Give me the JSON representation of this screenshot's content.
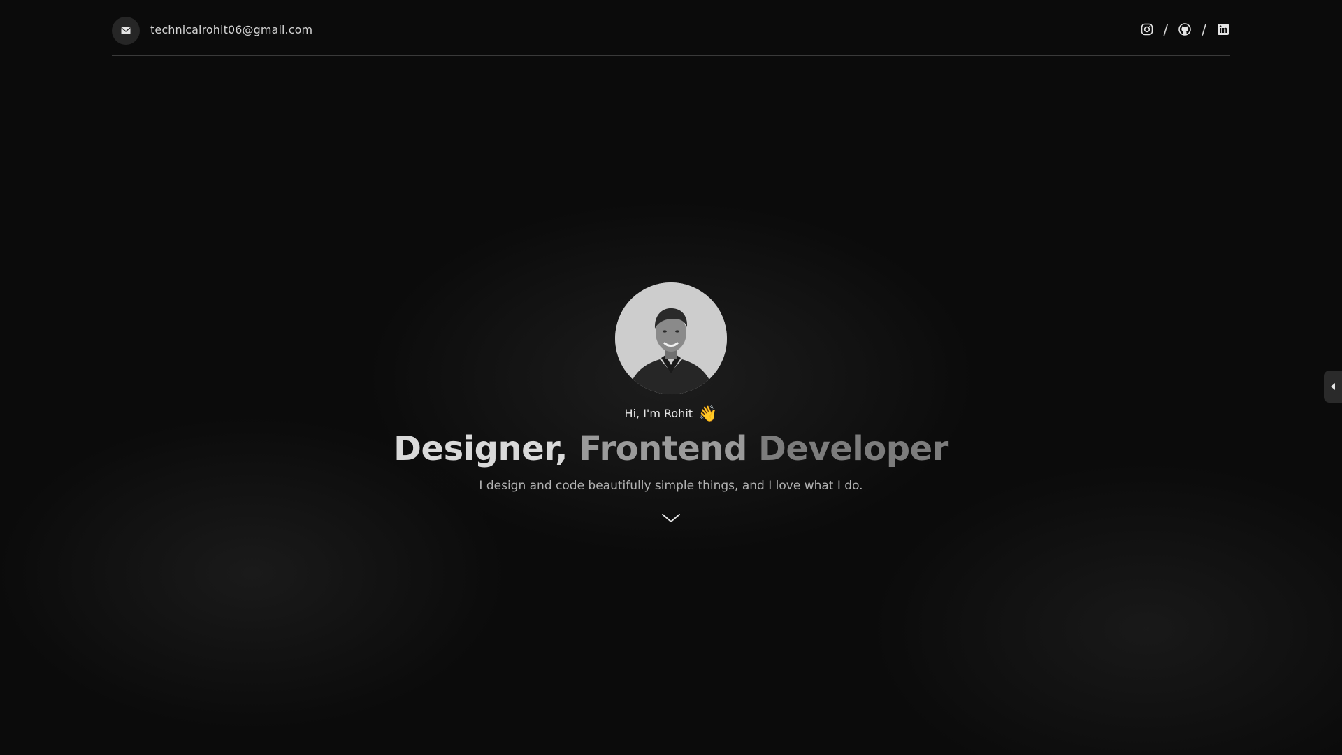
{
  "header": {
    "email": "technicalrohit06@gmail.com",
    "email_icon": "envelope-icon",
    "separator": "/",
    "socials": [
      {
        "icon": "instagram-icon"
      },
      {
        "icon": "github-icon"
      },
      {
        "icon": "linkedin-icon"
      }
    ]
  },
  "hero": {
    "avatar": "profile-photo",
    "greeting": "Hi, I'm Rohit",
    "greeting_emoji": "👋",
    "headline_part1": "Designer,",
    "headline_part2": "Frontend",
    "headline_part3": "Developer",
    "tagline": "I design and code beautifully simple things, and I love what I do.",
    "scroll_icon": "chevron-down-icon"
  },
  "side_tab": {
    "icon": "caret-left-icon"
  },
  "colors": {
    "background": "#0b0b0b",
    "divider": "#3a3a3a",
    "text": "#e5e5e5",
    "muted": "#b3b3b3"
  }
}
